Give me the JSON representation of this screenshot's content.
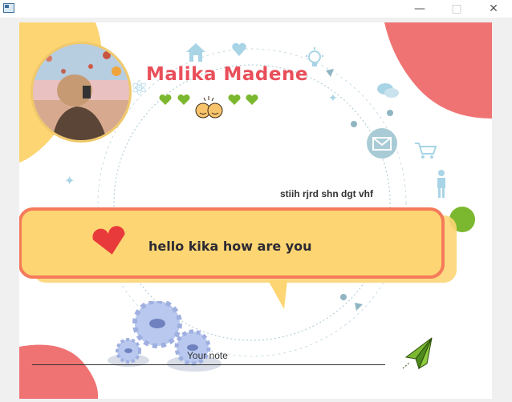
{
  "window": {
    "icon": "app-window-icon",
    "minimize_glyph": "—",
    "maximize_glyph": "□",
    "close_glyph": "✕"
  },
  "profile": {
    "name": "Malika Madene",
    "status_text": "stiih rjrd shn dgt vhf",
    "avatar_icon": "photo-avatar"
  },
  "message": {
    "text": "hello kika how are you"
  },
  "note": {
    "placeholder": "Your note",
    "value": ""
  },
  "icons": [
    "home-icon",
    "heart-icon",
    "lightbulb-icon",
    "chat-bubbles-icon",
    "mail-icon",
    "cart-icon",
    "person-icon",
    "gear-icon",
    "send-plane-icon",
    "sparkle-icon"
  ],
  "colors": {
    "accent_red": "#e94f5a",
    "coral": "#f07373",
    "bubble_fill": "#fdd573",
    "bubble_border": "#f57a5a",
    "green": "#7cb82f",
    "light_blue": "#a8d4e6"
  }
}
